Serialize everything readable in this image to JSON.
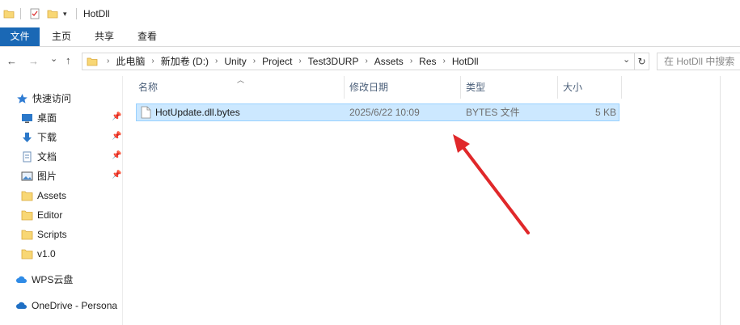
{
  "window": {
    "title": "HotDll",
    "quick_access_dropdown": "▾"
  },
  "ribbon": {
    "tabs": [
      "文件",
      "主页",
      "共享",
      "查看"
    ]
  },
  "address": {
    "back": "←",
    "forward": "→",
    "recent": "⌄",
    "up": "↑",
    "crumbs": [
      "此电脑",
      "新加卷 (D:)",
      "Unity",
      "Project",
      "Test3DURP",
      "Assets",
      "Res",
      "HotDll"
    ],
    "separator": "›",
    "dropdown": "⌄",
    "refresh": "↻",
    "search_placeholder": "在 HotDll 中搜索"
  },
  "nav": {
    "quick_access": "快速访问",
    "items": [
      {
        "label": "桌面",
        "icon": "desktop-icon",
        "pinned": true
      },
      {
        "label": "下载",
        "icon": "download-icon",
        "pinned": true
      },
      {
        "label": "文档",
        "icon": "document-icon",
        "pinned": true
      },
      {
        "label": "图片",
        "icon": "picture-icon",
        "pinned": true
      },
      {
        "label": "Assets",
        "icon": "folder-icon",
        "pinned": false
      },
      {
        "label": "Editor",
        "icon": "folder-icon",
        "pinned": false
      },
      {
        "label": "Scripts",
        "icon": "folder-icon",
        "pinned": false
      },
      {
        "label": "v1.0",
        "icon": "folder-icon",
        "pinned": false
      }
    ],
    "wps": "WPS云盘",
    "onedrive": "OneDrive - Persona"
  },
  "columns": {
    "name": "名称",
    "modified": "修改日期",
    "type": "类型",
    "size": "大小"
  },
  "files": [
    {
      "name": "HotUpdate.dll.bytes",
      "modified": "2025/6/22 10:09",
      "type": "BYTES 文件",
      "size": "5 KB"
    }
  ],
  "colors": {
    "accent": "#1a68b5",
    "selection_bg": "#cce8ff",
    "selection_border": "#99d1ff",
    "annotation_arrow": "#e0282a"
  }
}
